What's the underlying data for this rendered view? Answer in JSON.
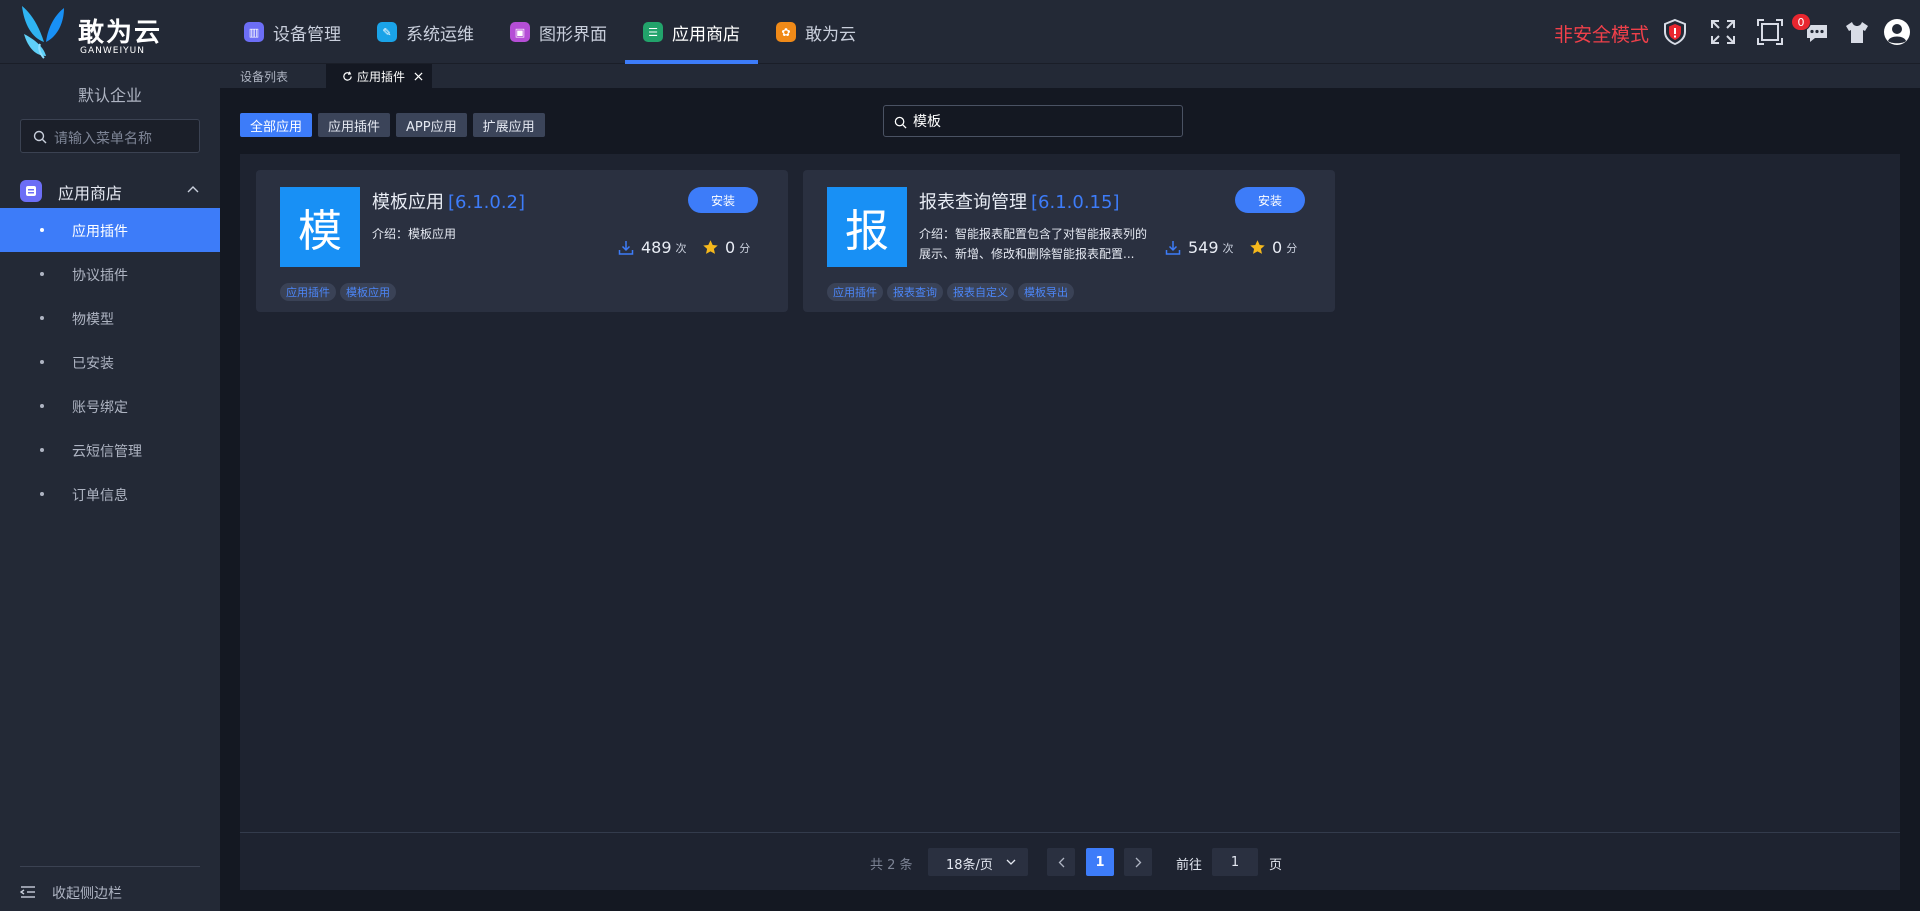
{
  "brand": {
    "name": "敢为云",
    "sub": "GANWEIYUN"
  },
  "topnav": [
    {
      "label": "设备管理",
      "icon": "device-icon",
      "color": "#6c6ef6",
      "glyph": "▥"
    },
    {
      "label": "系统运维",
      "icon": "wrench-icon",
      "color": "#1aa3e8",
      "glyph": "✎"
    },
    {
      "label": "图形界面",
      "icon": "graphic-icon",
      "color": "#b54ed6",
      "glyph": "▣"
    },
    {
      "label": "应用商店",
      "icon": "store-icon",
      "color": "#22a36b",
      "glyph": "☰",
      "active": true
    },
    {
      "label": "敢为云",
      "icon": "cloud-icon",
      "color": "#f08a18",
      "glyph": "✿"
    }
  ],
  "header": {
    "mode_label": "非安全模式",
    "notification_count": "0"
  },
  "sidebar": {
    "enterprise": "默认企业",
    "search_placeholder": "请输入菜单名称",
    "group_label": "应用商店",
    "items": [
      {
        "label": "应用插件",
        "active": true
      },
      {
        "label": "协议插件"
      },
      {
        "label": "物模型"
      },
      {
        "label": "已安装"
      },
      {
        "label": "账号绑定"
      },
      {
        "label": "云短信管理"
      },
      {
        "label": "订单信息"
      }
    ],
    "collapse_label": "收起侧边栏"
  },
  "tabs": [
    {
      "label": "设备列表"
    },
    {
      "label": "应用插件",
      "active": true
    }
  ],
  "filters": [
    "全部应用",
    "应用插件",
    "APP应用",
    "扩展应用"
  ],
  "search": {
    "value": "模板"
  },
  "cards": [
    {
      "logo_char": "模",
      "name": "模板应用",
      "version": "[6.1.0.2]",
      "desc_prefix": "介绍：",
      "desc": "模板应用",
      "install_label": "安装",
      "downloads": "489",
      "downloads_unit": "次",
      "rating": "0",
      "rating_unit": "分",
      "tags": [
        "应用插件",
        "模板应用"
      ]
    },
    {
      "logo_char": "报",
      "name": "报表查询管理",
      "version": "[6.1.0.15]",
      "desc_prefix": "介绍：",
      "desc": "智能报表配置包含了对智能报表列的展示、新增、修改和删除智能报表配置...",
      "install_label": "安装",
      "downloads": "549",
      "downloads_unit": "次",
      "rating": "0",
      "rating_unit": "分",
      "tags": [
        "应用插件",
        "报表查询",
        "报表自定义",
        "模板导出"
      ]
    }
  ],
  "pagination": {
    "total": "共 2 条",
    "page_size": "18条/页",
    "current": "1",
    "goto_prefix": "前往",
    "goto_value": "1",
    "goto_suffix": "页"
  },
  "colors": {
    "accent": "#3d7cf9",
    "danger": "#f0404a",
    "logo_blue": "#1890f5",
    "star": "#f5b81c"
  }
}
